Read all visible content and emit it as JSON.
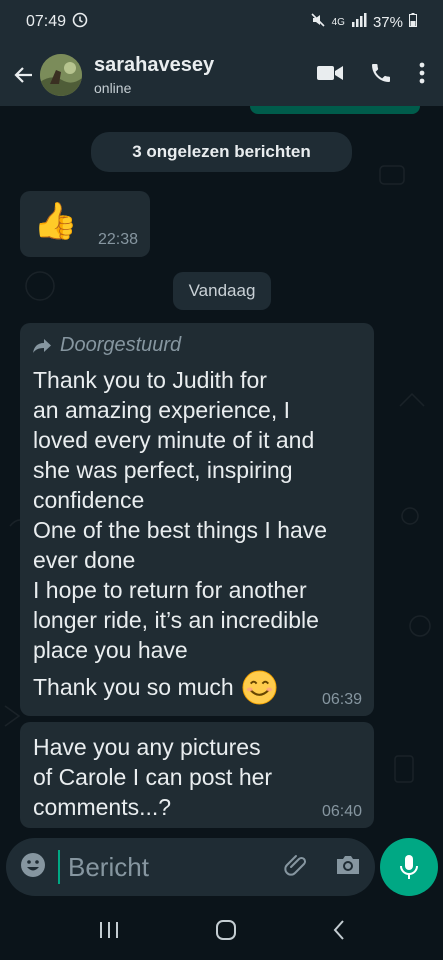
{
  "status_bar": {
    "time": "07:49",
    "network": "4G",
    "battery": "37%"
  },
  "header": {
    "contact_name": "sarahavesey",
    "presence": "online"
  },
  "chat": {
    "unread_notice": "3 ongelezen berichten",
    "day_divider": "Vandaag",
    "messages": [
      {
        "text": "👍",
        "time": "22:38"
      },
      {
        "forwarded_label": "Doorgestuurd",
        "lines": [
          "Thank you to Judith for",
          "an amazing experience, I",
          "loved every minute of it and",
          "she was perfect, inspiring",
          "confidence",
          "One of the best things I have",
          "ever done",
          "I hope to return for another",
          "longer ride, it’s an incredible",
          "place you have"
        ],
        "last_line": "Thank you so much",
        "time": "06:39"
      },
      {
        "lines": [
          "Have you any pictures",
          "of Carole I can post her",
          "comments...?"
        ],
        "time": "06:40"
      }
    ]
  },
  "composer": {
    "placeholder": "Bericht"
  },
  "colors": {
    "accent": "#00a884",
    "bubble_incoming": "#202c33",
    "bar": "#1f2c34",
    "background": "#0b141a"
  }
}
